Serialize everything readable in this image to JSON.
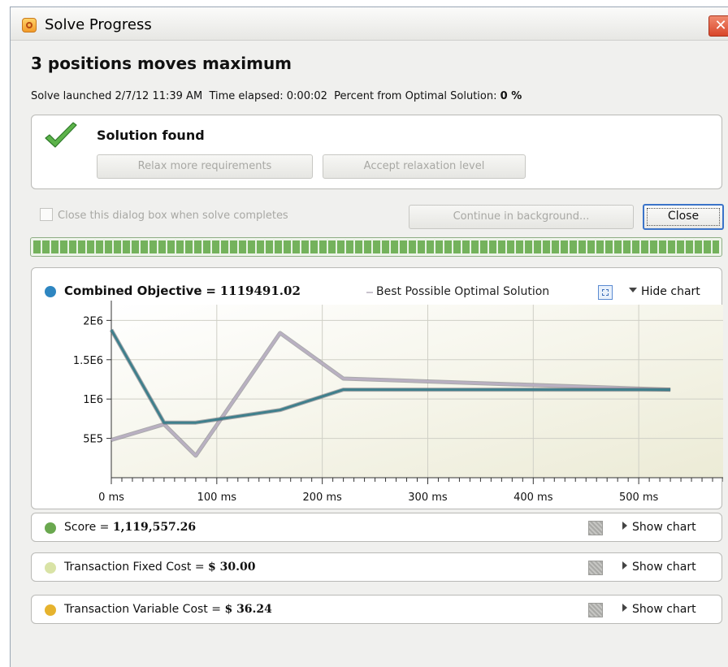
{
  "window": {
    "title": "Solve Progress",
    "close_glyph": "✕"
  },
  "heading": "3 positions moves maximum",
  "status": {
    "launched_label": "Solve launched",
    "launched_value": "2/7/12 11:39 AM",
    "elapsed_label": "Time elapsed:",
    "elapsed_value": "0:00:02",
    "percent_label": "Percent from Optimal Solution:",
    "percent_value": "0 %"
  },
  "solution": {
    "label": "Solution found",
    "icon": "checkmark-icon",
    "relax_button": "Relax more requirements",
    "accept_button": "Accept relaxation level"
  },
  "controls": {
    "close_when_complete": "Close this dialog box when solve completes",
    "close_when_complete_checked": false,
    "continue_button": "Continue in background...",
    "close_button": "Close"
  },
  "progress": {
    "complete_fraction": 1.0
  },
  "objective": {
    "name": "Combined Objective",
    "equals": "=",
    "value": "1119491.02",
    "best_label": "Best Possible Optimal Solution",
    "hide_chart": "Hide chart",
    "dot_color": "#2e86c1"
  },
  "metrics": [
    {
      "name": "Score",
      "value": "1,119,557.26",
      "show_chart": "Show chart",
      "dot_color": "#6aa84f"
    },
    {
      "name": "Transaction Fixed Cost",
      "value": "$ 30.00",
      "show_chart": "Show chart",
      "dot_color": "#d9e3a6"
    },
    {
      "name": "Transaction Variable Cost",
      "value": "$ 36.24",
      "show_chart": "Show chart",
      "dot_color": "#e6b32e"
    }
  ],
  "chart_data": {
    "type": "line",
    "x_unit": "ms",
    "xlim": [
      0,
      580
    ],
    "ylim": [
      0,
      2200000
    ],
    "x_ticks": [
      {
        "value": 0,
        "label": "0 ms"
      },
      {
        "value": 100,
        "label": "100 ms"
      },
      {
        "value": 200,
        "label": "200 ms"
      },
      {
        "value": 300,
        "label": "300 ms"
      },
      {
        "value": 400,
        "label": "400 ms"
      },
      {
        "value": 500,
        "label": "500 ms"
      }
    ],
    "y_ticks": [
      {
        "value": 500000,
        "label": "5E5"
      },
      {
        "value": 1000000,
        "label": "1E6"
      },
      {
        "value": 1500000,
        "label": "1.5E6"
      },
      {
        "value": 2000000,
        "label": "2E6"
      }
    ],
    "grid": true,
    "series": [
      {
        "name": "Combined Objective",
        "color": "#3f7f8c",
        "x": [
          0,
          50,
          80,
          160,
          220,
          530
        ],
        "y": [
          1880000,
          700000,
          700000,
          860000,
          1120000,
          1119491.02
        ]
      },
      {
        "name": "Best Possible Optimal Solution",
        "color": "#b9b0c2",
        "x": [
          0,
          50,
          80,
          160,
          220,
          530
        ],
        "y": [
          480000,
          680000,
          280000,
          1840000,
          1260000,
          1119491.02
        ]
      }
    ]
  }
}
